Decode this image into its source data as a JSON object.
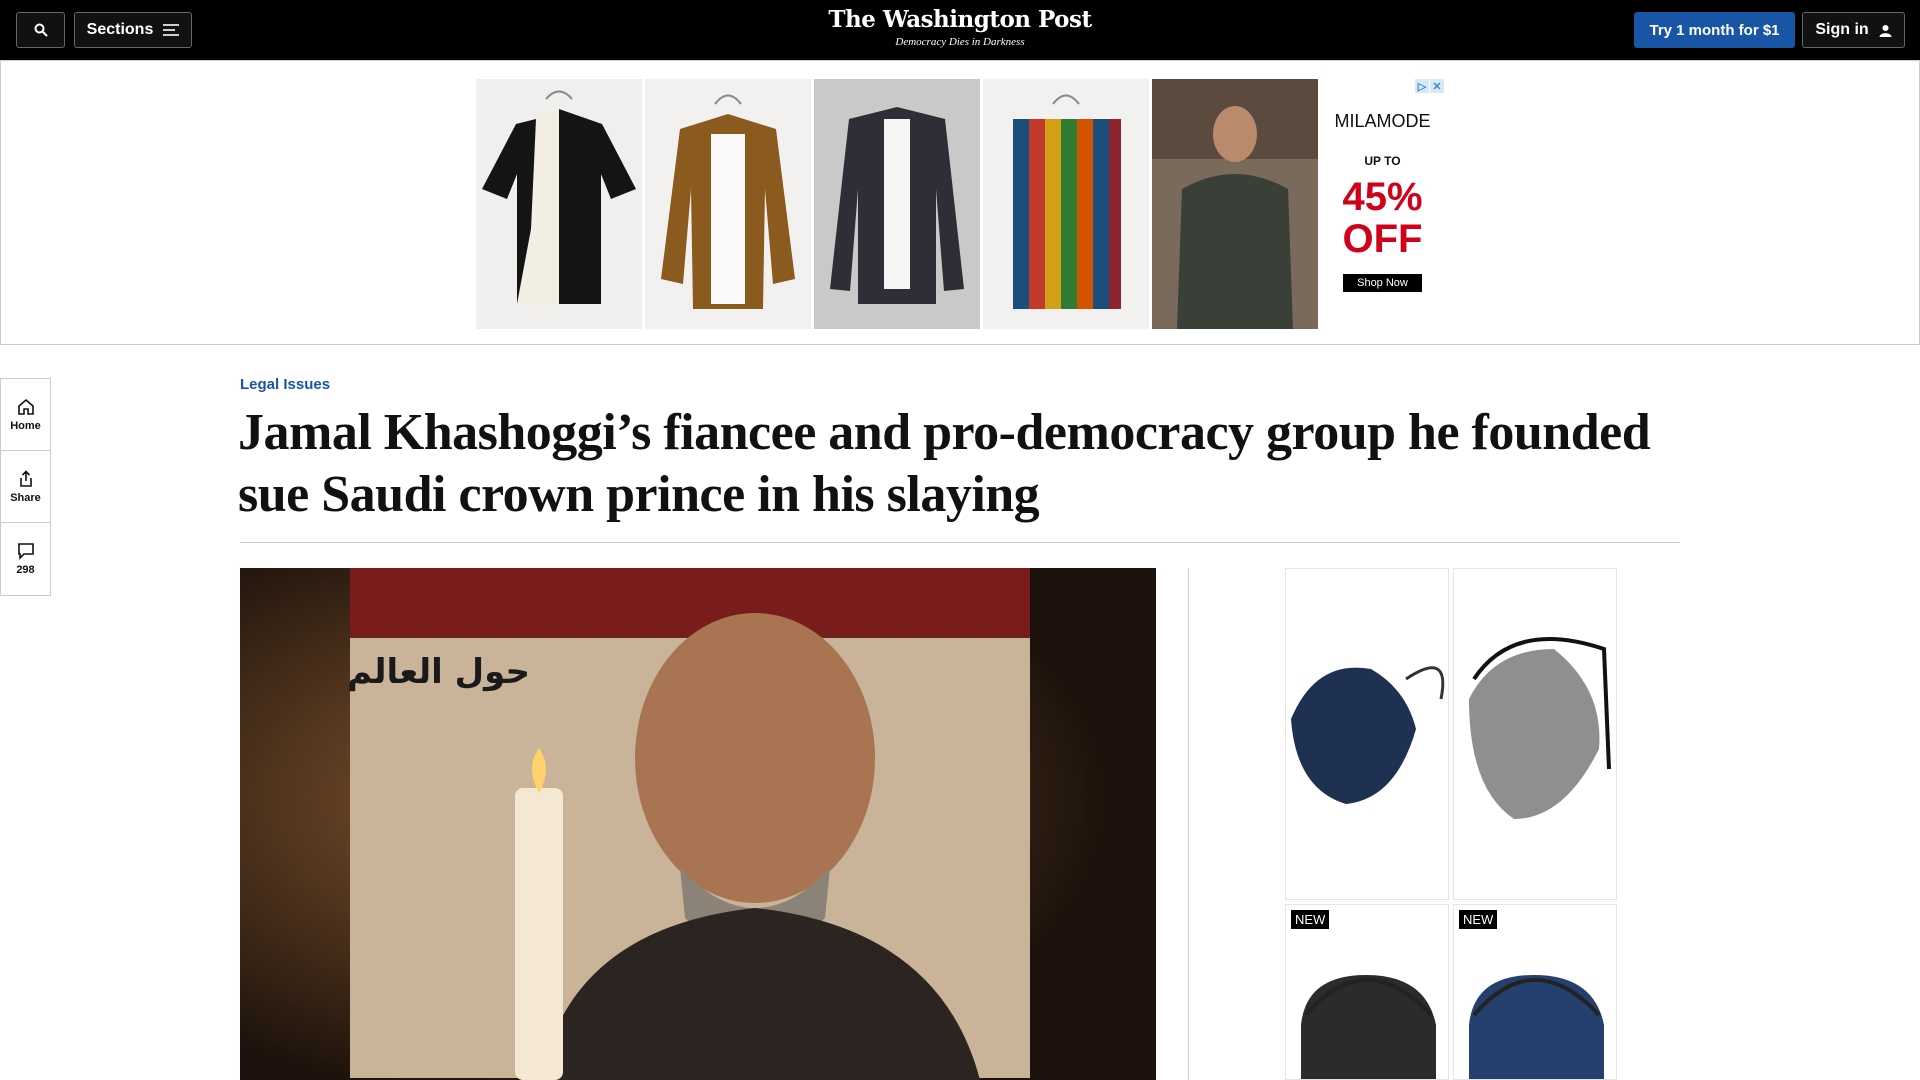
{
  "header": {
    "search_icon": "search-icon",
    "sections_label": "Sections",
    "logo": "The Washington Post",
    "tagline": "Democracy Dies in Darkness",
    "trial_label": "Try 1 month for $1",
    "signin_label": "Sign in"
  },
  "top_ad": {
    "brand": "MILAMODE",
    "up_to": "UP TO",
    "discount": "45%",
    "off": "OFF",
    "cta": "Shop Now",
    "adchoices": [
      "▷",
      "✕"
    ]
  },
  "rail": [
    {
      "label": "Home",
      "icon": "home-icon"
    },
    {
      "label": "Share",
      "icon": "share-icon"
    },
    {
      "label": "298",
      "icon": "comment-icon"
    }
  ],
  "article": {
    "kicker": "Legal Issues",
    "headline": "Jamal Khashoggi’s fiancee and pro-democracy group he founded sue Saudi crown prince in his slaying",
    "photo_sign_text": "حول العالم"
  },
  "side_ad": {
    "new_labels": [
      "NEW",
      "NEW"
    ],
    "adchoices": [
      "▷",
      "✕"
    ]
  }
}
